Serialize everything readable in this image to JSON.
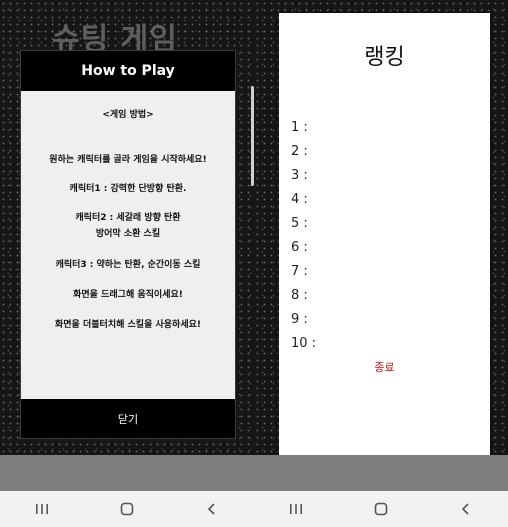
{
  "left_screen": {
    "game_title": "슈팅 게임",
    "how_to_play": {
      "header": "How to Play",
      "lines": [
        "<게임 방법>",
        "원하는 캐릭터를 골라 게임을 시작하세요!",
        "캐릭터1 : 강력한 단방향 탄환.",
        "캐릭터2 : 세갈래 방향 탄환",
        "방어막 소환 스킬",
        "캐릭터3 : 약하는 탄환, 순간이동 스킬",
        "화면을 드래그해 움직이세요!",
        "화면을 더블터치해 스킬을 사용하세요!"
      ],
      "close_label": "닫기"
    }
  },
  "right_screen": {
    "ranking": {
      "title": "랭킹",
      "rows": [
        "1 :",
        "2 :",
        "3 :",
        "4 :",
        "5 :",
        "6 :",
        "7 :",
        "8 :",
        "9 :",
        "10 :"
      ],
      "close_label": "종료"
    }
  },
  "nav_bar": {
    "icons": [
      "recent-apps-icon",
      "home-icon",
      "back-icon"
    ]
  },
  "colors": {
    "close_text": "#c01616",
    "dialog_bg": "#efefef",
    "header_bg": "#000000"
  }
}
